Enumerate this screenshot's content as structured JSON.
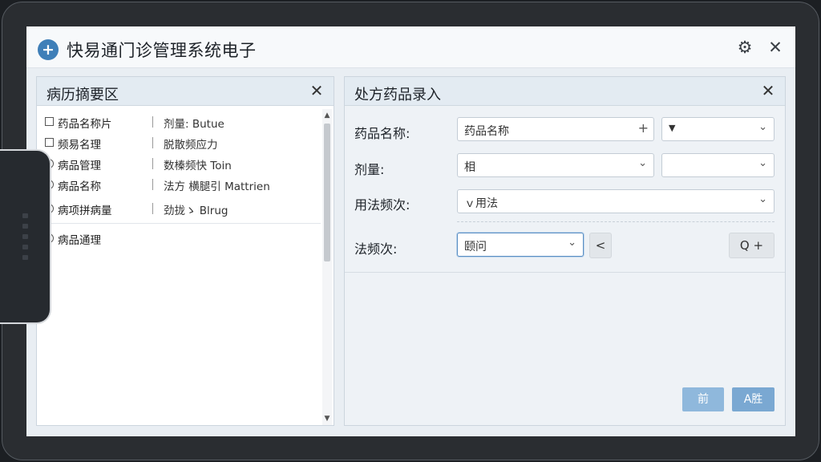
{
  "window": {
    "title": "快易通门诊管理系统电子"
  },
  "left_panel": {
    "title": "病历摘要区",
    "rows": [
      {
        "marker": "check",
        "name": "药品名称片",
        "value": "剂量: Butue"
      },
      {
        "marker": "check",
        "name": "频易名理",
        "value": "脱散频应力"
      },
      {
        "marker": "radio",
        "name": "病品管理",
        "value": "数榛频快 Toin"
      },
      {
        "marker": "radio",
        "name": "病品名称",
        "value": "法方 横腿引 Mattrien"
      },
      {
        "marker": "radio",
        "name": "病项拼病量",
        "value": "劲拢ゝ Blrug"
      },
      {
        "marker": "radio",
        "name": "病品通理",
        "value": ""
      }
    ]
  },
  "right_panel": {
    "title": "处方药品录入",
    "drug_name": {
      "label": "药品名称:",
      "value": "药品名称",
      "secondary_value": ""
    },
    "dosage": {
      "label": "剂量:",
      "value": "相",
      "secondary_value": ""
    },
    "usage": {
      "label": "用法频次:",
      "value": "ｖ用法"
    },
    "frequency": {
      "label": "法频次:",
      "value": "颐问"
    },
    "back_label": "<",
    "search_add_label": "Q +",
    "prev_label": "前",
    "next_label": "A胜"
  }
}
